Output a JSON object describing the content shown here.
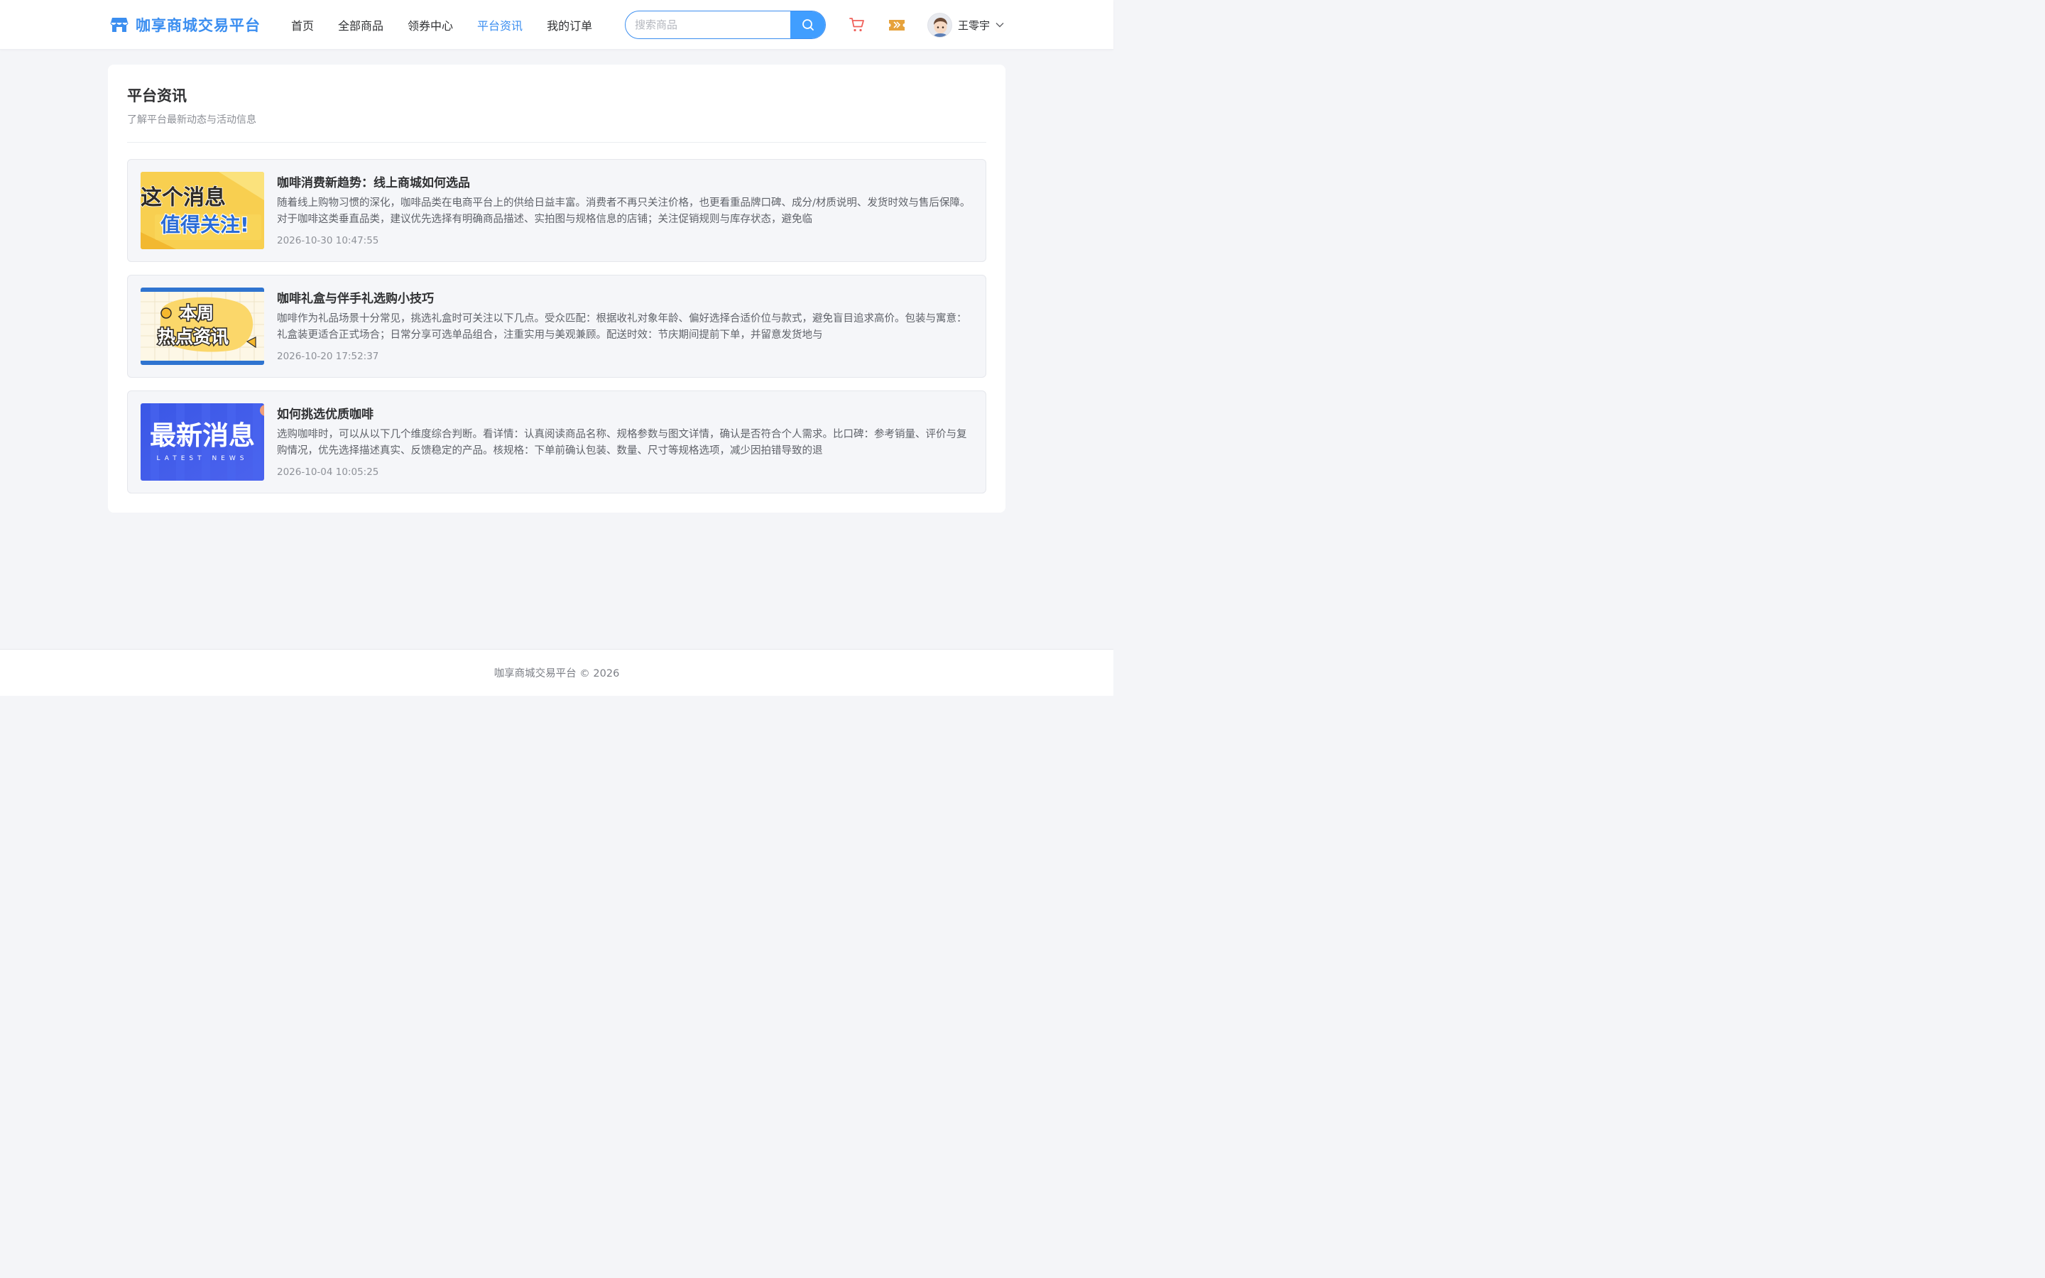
{
  "brand": {
    "name": "咖享商城交易平台"
  },
  "nav": {
    "items": [
      {
        "label": "首页",
        "active": false
      },
      {
        "label": "全部商品",
        "active": false
      },
      {
        "label": "领券中心",
        "active": false
      },
      {
        "label": "平台资讯",
        "active": true
      },
      {
        "label": "我的订单",
        "active": false
      }
    ]
  },
  "search": {
    "placeholder": "搜索商品",
    "value": ""
  },
  "user": {
    "name": "王零宇"
  },
  "page": {
    "title": "平台资讯",
    "subtitle": "了解平台最新动态与活动信息"
  },
  "news": [
    {
      "title": "咖啡消费新趋势：线上商城如何选品",
      "summary": "随着线上购物习惯的深化，咖啡品类在电商平台上的供给日益丰富。消费者不再只关注价格，也更看重品牌口碑、成分/材质说明、发货时效与售后保障。对于咖啡这类垂直品类，建议优先选择有明确商品描述、实拍图与规格信息的店铺；关注促销规则与库存状态，避免临",
      "time": "2026-10-30 10:47:55",
      "thumb": {
        "line1": "这个消息",
        "line2": "值得关注!",
        "icon": "yellow-banner-image"
      }
    },
    {
      "title": "咖啡礼盒与伴手礼选购小技巧",
      "summary": "咖啡作为礼品场景十分常见，挑选礼盒时可关注以下几点。受众匹配：根据收礼对象年龄、偏好选择合适价位与款式，避免盲目追求高价。包装与寓意：礼盒装更适合正式场合；日常分享可选单品组合，注重实用与美观兼顾。配送时效：节庆期间提前下单，并留意发货地与",
      "time": "2026-10-20 17:52:37",
      "thumb": {
        "line1": "本周",
        "line2": "热点资讯",
        "icon": "weekly-hot-news-image"
      }
    },
    {
      "title": "如何挑选优质咖啡",
      "summary": "选购咖啡时，可以从以下几个维度综合判断。看详情：认真阅读商品名称、规格参数与图文详情，确认是否符合个人需求。比口碑：参考销量、评价与复购情况，优先选择描述真实、反馈稳定的产品。核规格：下单前确认包装、数量、尺寸等规格选项，减少因拍错导致的退",
      "time": "2026-10-04 10:05:25",
      "thumb": {
        "line1": "最新消息",
        "line2": "LATEST NEWS",
        "icon": "latest-news-image"
      }
    }
  ],
  "footer": {
    "text": "咖享商城交易平台 © 2026"
  },
  "colors": {
    "accent": "#409eff",
    "brand": "#3b8ef0",
    "cart": "#f0605a",
    "ticket": "#e6a23c"
  }
}
